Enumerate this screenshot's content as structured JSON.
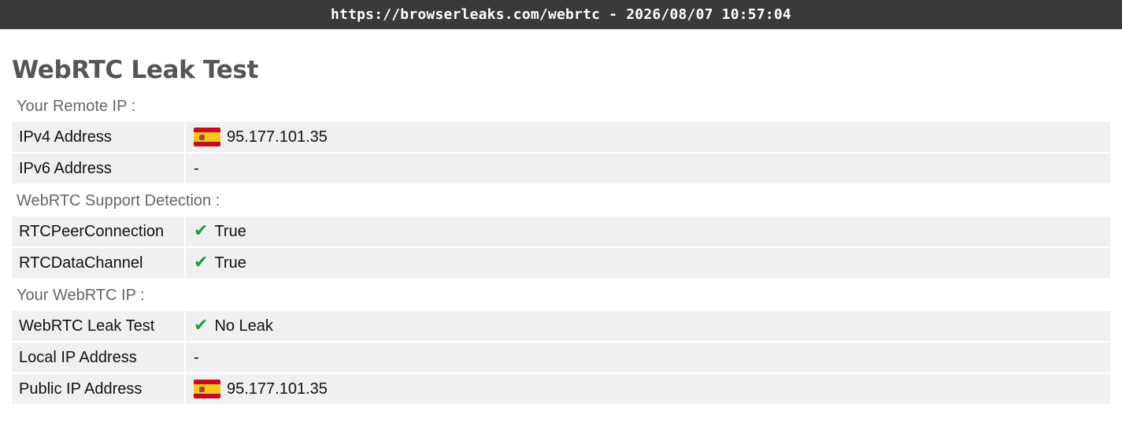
{
  "topbar": {
    "url_timestamp": "https://browserleaks.com/webrtc - 2026/08/07 10:57:04"
  },
  "page": {
    "title": "WebRTC Leak Test"
  },
  "colors": {
    "check_green": "#14a13c",
    "flag_red": "#c60b1e",
    "flag_yellow": "#f7c81c",
    "emblem": "#a8453a"
  },
  "icons": {
    "flag": "spain-flag-icon",
    "check": "checkmark-icon"
  },
  "remote_ip": {
    "heading": "Your Remote IP :",
    "rows": [
      {
        "label": "IPv4 Address",
        "value": "95.177.101.35",
        "flag": "ES"
      },
      {
        "label": "IPv6 Address",
        "value": "-"
      }
    ]
  },
  "support": {
    "heading": "WebRTC Support Detection :",
    "rows": [
      {
        "label": "RTCPeerConnection",
        "check": "✔",
        "value": "True"
      },
      {
        "label": "RTCDataChannel",
        "check": "✔",
        "value": "True"
      }
    ]
  },
  "webrtc_ip": {
    "heading": "Your WebRTC IP :",
    "rows": [
      {
        "label": "WebRTC Leak Test",
        "check": "✔",
        "value": "No Leak"
      },
      {
        "label": "Local IP Address",
        "value": "-"
      },
      {
        "label": "Public IP Address",
        "value": "95.177.101.35",
        "flag": "ES"
      }
    ]
  }
}
